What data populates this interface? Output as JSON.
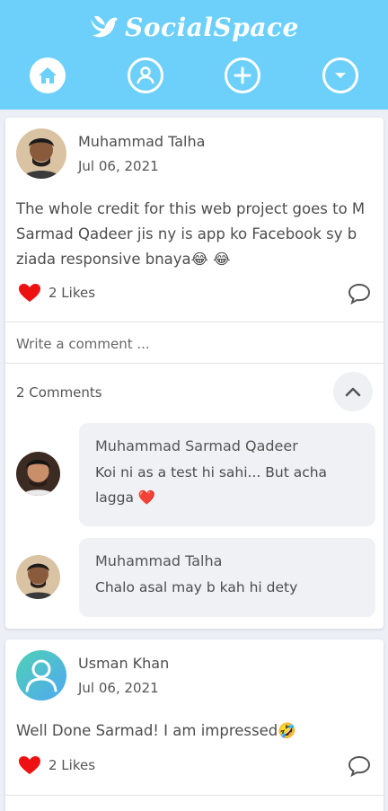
{
  "app": {
    "title": "SocialSpace"
  },
  "colors": {
    "header": "#6cd0fb",
    "like": "#ee1111"
  },
  "nav": [
    {
      "name": "home",
      "icon": "home-icon",
      "active": true
    },
    {
      "name": "profile",
      "icon": "user-icon"
    },
    {
      "name": "create",
      "icon": "plus-icon"
    },
    {
      "name": "menu",
      "icon": "chevron-down-icon"
    }
  ],
  "posts": [
    {
      "author": "Muhammad Talha",
      "date": "Jul 06, 2021",
      "text": "The whole credit for this web project goes to M Sarmad Qadeer jis ny is app ko Facebook sy b ziada responsive bnaya😂 😂",
      "likes": "2 Likes",
      "comment_placeholder": "Write a comment ...",
      "comments_count": "2 Comments",
      "comments": [
        {
          "author": "Muhammad Sarmad Qadeer",
          "text": "Koi ni as a test hi sahi... But acha lagga ❤️"
        },
        {
          "author": "Muhammad Talha",
          "text": "Chalo asal may b kah hi dety"
        }
      ]
    },
    {
      "author": "Usman Khan",
      "date": "Jul 06, 2021",
      "text": "Well Done Sarmad! I am impressed🤣",
      "likes": "2 Likes"
    }
  ]
}
